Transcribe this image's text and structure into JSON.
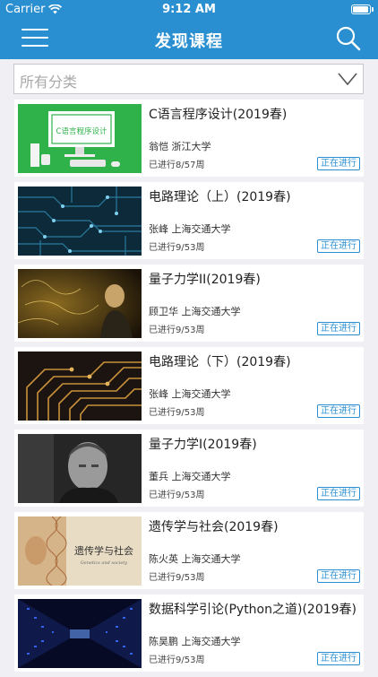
{
  "status_bar": {
    "carrier": "Carrier",
    "time": "9:12 AM"
  },
  "nav": {
    "title": "发现课程",
    "menu_icon": "hamburger-menu-icon",
    "search_icon": "search-icon"
  },
  "filter": {
    "label": "所有分类",
    "icon": "chevron-down-icon"
  },
  "courses": [
    {
      "title": "C语言程序设计(2019春)",
      "teacher": "翁恺 浙江大学",
      "progress": "已进行8/57周",
      "status": "正在进行",
      "thumb_text": "C语言程序设计"
    },
    {
      "title": "电路理论（上）(2019春)",
      "teacher": "张峰 上海交通大学",
      "progress": "已进行9/53周",
      "status": "正在进行"
    },
    {
      "title": "量子力学II(2019春)",
      "teacher": "顾卫华 上海交通大学",
      "progress": "已进行9/53周",
      "status": "正在进行"
    },
    {
      "title": "电路理论（下）(2019春)",
      "teacher": "张峰 上海交通大学",
      "progress": "已进行9/53周",
      "status": "正在进行"
    },
    {
      "title": "量子力学I(2019春)",
      "teacher": "董兵 上海交通大学",
      "progress": "已进行9/53周",
      "status": "正在进行"
    },
    {
      "title": "遗传学与社会(2019春)",
      "teacher": "陈火英 上海交通大学",
      "progress": "已进行9/53周",
      "status": "正在进行",
      "thumb_text": "遗传学与社会",
      "thumb_subtext": "Genetics and society"
    },
    {
      "title": "数据科学引论(Python之道)(2019春)",
      "teacher": "陈昊鹏 上海交通大学",
      "progress": "已进行9/53周",
      "status": "正在进行"
    }
  ]
}
